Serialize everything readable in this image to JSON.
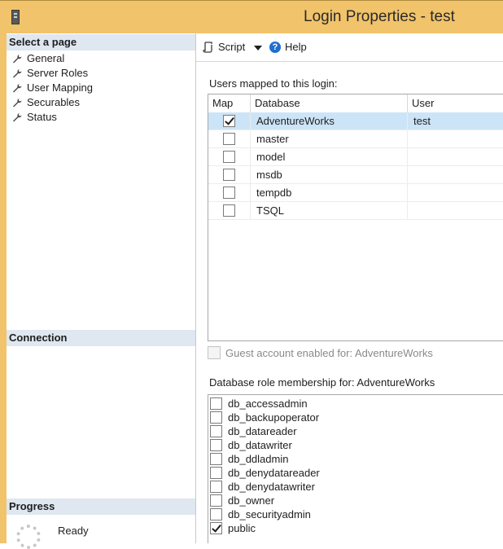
{
  "window": {
    "title": "Login Properties - test"
  },
  "left": {
    "select_page_header": "Select a page",
    "pages": [
      {
        "label": "General",
        "selected": false
      },
      {
        "label": "Server Roles",
        "selected": false
      },
      {
        "label": "User Mapping",
        "selected": true
      },
      {
        "label": "Securables",
        "selected": false
      },
      {
        "label": "Status",
        "selected": false
      }
    ],
    "connection_header": "Connection",
    "progress_header": "Progress",
    "progress_status": "Ready"
  },
  "toolbar": {
    "script_label": "Script",
    "help_label": "Help"
  },
  "mapping": {
    "title": "Users mapped to this login:",
    "columns": {
      "map": "Map",
      "database": "Database",
      "user": "User"
    },
    "rows": [
      {
        "mapped": true,
        "database": "AdventureWorks",
        "user": "test",
        "selected": true
      },
      {
        "mapped": false,
        "database": "master",
        "user": "",
        "selected": false
      },
      {
        "mapped": false,
        "database": "model",
        "user": "",
        "selected": false
      },
      {
        "mapped": false,
        "database": "msdb",
        "user": "",
        "selected": false
      },
      {
        "mapped": false,
        "database": "tempdb",
        "user": "",
        "selected": false
      },
      {
        "mapped": false,
        "database": "TSQL",
        "user": "",
        "selected": false
      }
    ]
  },
  "guest": {
    "label": "Guest account enabled for: AdventureWorks",
    "checked": false,
    "enabled": false
  },
  "roles": {
    "title": "Database role membership for: AdventureWorks",
    "items": [
      {
        "label": "db_accessadmin",
        "checked": false
      },
      {
        "label": "db_backupoperator",
        "checked": false
      },
      {
        "label": "db_datareader",
        "checked": false
      },
      {
        "label": "db_datawriter",
        "checked": false
      },
      {
        "label": "db_ddladmin",
        "checked": false
      },
      {
        "label": "db_denydatareader",
        "checked": false
      },
      {
        "label": "db_denydatawriter",
        "checked": false
      },
      {
        "label": "db_owner",
        "checked": false
      },
      {
        "label": "db_securityadmin",
        "checked": false
      },
      {
        "label": "public",
        "checked": true
      }
    ]
  }
}
